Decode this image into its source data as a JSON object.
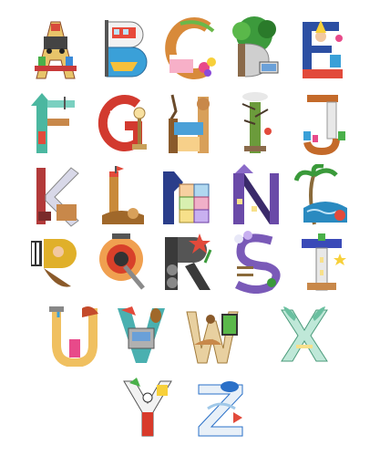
{
  "poster": {
    "letters": [
      {
        "char": "A",
        "icon": "train-castle-icon",
        "color": "#e24a3b"
      },
      {
        "char": "B",
        "icon": "bus-boat-icon",
        "color": "#2fa7d6"
      },
      {
        "char": "C",
        "icon": "cake-chameleon-icon",
        "color": "#f39a2b"
      },
      {
        "char": "D",
        "icon": "tree-laptop-icon",
        "color": "#3c9a3c"
      },
      {
        "char": "E",
        "icon": "elf-wizard-icon",
        "color": "#2c4fa3"
      },
      {
        "char": "F",
        "icon": "factory-flag-icon",
        "color": "#4bb7a0"
      },
      {
        "char": "G",
        "icon": "guitar-gramophone-icon",
        "color": "#d23a2f"
      },
      {
        "char": "H",
        "icon": "house-tree-icon",
        "color": "#8a5a2b"
      },
      {
        "char": "I",
        "icon": "ice-tree-icon",
        "color": "#6b9b3b"
      },
      {
        "char": "J",
        "icon": "jar-jewels-icon",
        "color": "#c46a2a"
      },
      {
        "char": "K",
        "icon": "kite-boot-icon",
        "color": "#b23a3a"
      },
      {
        "char": "L",
        "icon": "lighthouse-lion-icon",
        "color": "#c98a3a"
      },
      {
        "char": "M",
        "icon": "map-blocks-icon",
        "color": "#2a3d8a"
      },
      {
        "char": "N",
        "icon": "night-city-icon",
        "color": "#6a4aa8"
      },
      {
        "char": "O",
        "icon": "ocean-palm-icon",
        "color": "#2a8ac0"
      },
      {
        "char": "P",
        "icon": "piano-pirate-icon",
        "color": "#e0b02a"
      },
      {
        "char": "Q",
        "icon": "queen-drum-icon",
        "color": "#d8402a"
      },
      {
        "char": "R",
        "icon": "robot-rose-icon",
        "color": "#3a3a3a"
      },
      {
        "char": "S",
        "icon": "swing-flowers-icon",
        "color": "#7a5ab8"
      },
      {
        "char": "T",
        "icon": "tower-star-icon",
        "color": "#3a4ab8"
      },
      {
        "char": "U",
        "icon": "umbrella-tap-icon",
        "color": "#c44a2a"
      },
      {
        "char": "V",
        "icon": "violin-van-icon",
        "color": "#4ab0b0"
      },
      {
        "char": "W",
        "icon": "window-cake-icon",
        "color": "#a07a3a"
      },
      {
        "char": "X",
        "icon": "xylophone-butterfly-icon",
        "color": "#6ac0a0"
      },
      {
        "char": "Y",
        "icon": "yoyo-snoopy-icon",
        "color": "#d83a2a"
      },
      {
        "char": "Z",
        "icon": "zebra-zeppelin-icon",
        "color": "#2a70c8"
      }
    ]
  }
}
